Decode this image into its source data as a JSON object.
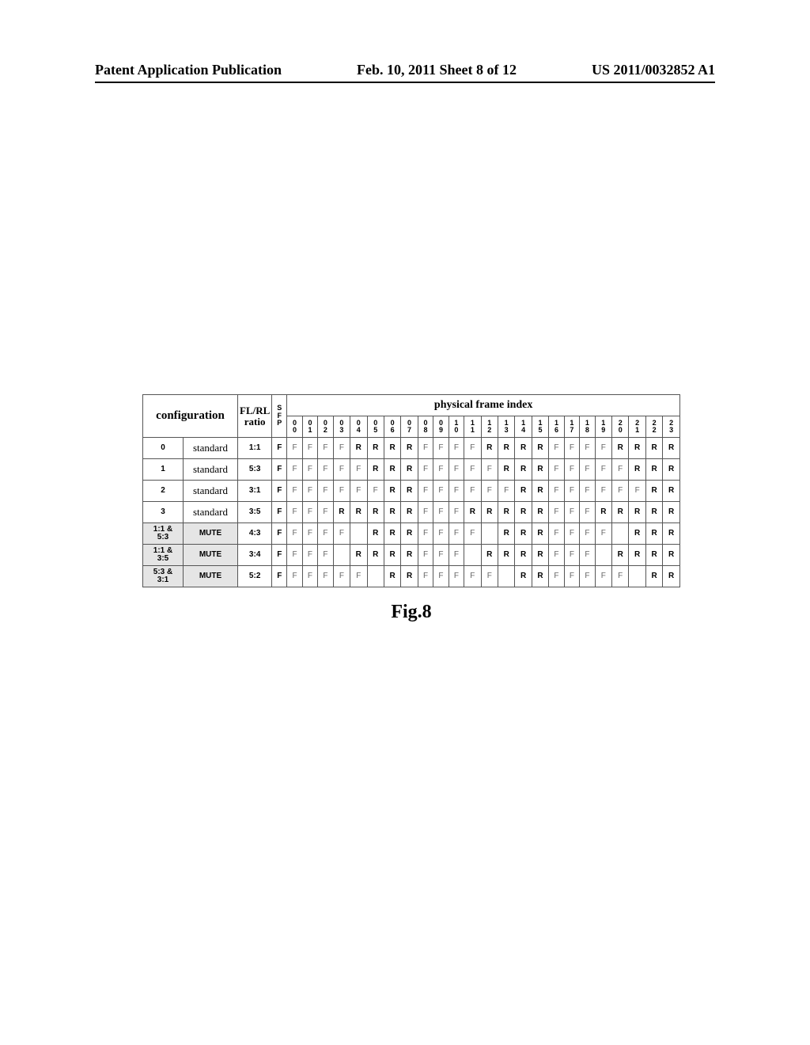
{
  "header": {
    "left": "Patent Application Publication",
    "mid": "Feb. 10, 2011  Sheet 8 of 12",
    "right": "US 2011/0032852 A1"
  },
  "labels": {
    "configuration": "configuration",
    "ratio_hdr_l1": "FL/RL",
    "ratio_hdr_l2": "ratio",
    "sfp_l1": "S",
    "sfp_l2": "F",
    "sfp_l3": "P",
    "pfi": "physical frame index",
    "figcap": "Fig.8"
  },
  "cols": [
    {
      "l1": "0",
      "l2": "0"
    },
    {
      "l1": "0",
      "l2": "1"
    },
    {
      "l1": "0",
      "l2": "2"
    },
    {
      "l1": "0",
      "l2": "3"
    },
    {
      "l1": "0",
      "l2": "4"
    },
    {
      "l1": "0",
      "l2": "5"
    },
    {
      "l1": "0",
      "l2": "6"
    },
    {
      "l1": "0",
      "l2": "7"
    },
    {
      "l1": "0",
      "l2": "8"
    },
    {
      "l1": "0",
      "l2": "9"
    },
    {
      "l1": "1",
      "l2": "0"
    },
    {
      "l1": "1",
      "l2": "1"
    },
    {
      "l1": "1",
      "l2": "2"
    },
    {
      "l1": "1",
      "l2": "3"
    },
    {
      "l1": "1",
      "l2": "4"
    },
    {
      "l1": "1",
      "l2": "5"
    },
    {
      "l1": "1",
      "l2": "6"
    },
    {
      "l1": "1",
      "l2": "7"
    },
    {
      "l1": "1",
      "l2": "8"
    },
    {
      "l1": "1",
      "l2": "9"
    },
    {
      "l1": "2",
      "l2": "0"
    },
    {
      "l1": "2",
      "l2": "1"
    },
    {
      "l1": "2",
      "l2": "2"
    },
    {
      "l1": "2",
      "l2": "3"
    }
  ],
  "rows": [
    {
      "cfg1": "0",
      "cfg2": "standard",
      "ratio": "1:1",
      "sfp": "F",
      "mute": false,
      "cells": [
        {
          "t": "F",
          "b": false
        },
        {
          "t": "F",
          "b": false
        },
        {
          "t": "F",
          "b": false
        },
        {
          "t": "F",
          "b": false
        },
        {
          "t": "R",
          "b": true
        },
        {
          "t": "R",
          "b": true
        },
        {
          "t": "R",
          "b": true
        },
        {
          "t": "R",
          "b": true
        },
        {
          "t": "F",
          "b": false
        },
        {
          "t": "F",
          "b": false
        },
        {
          "t": "F",
          "b": false
        },
        {
          "t": "F",
          "b": false
        },
        {
          "t": "R",
          "b": true
        },
        {
          "t": "R",
          "b": true
        },
        {
          "t": "R",
          "b": true
        },
        {
          "t": "R",
          "b": true
        },
        {
          "t": "F",
          "b": false
        },
        {
          "t": "F",
          "b": false
        },
        {
          "t": "F",
          "b": false
        },
        {
          "t": "F",
          "b": false
        },
        {
          "t": "R",
          "b": true
        },
        {
          "t": "R",
          "b": true
        },
        {
          "t": "R",
          "b": true
        },
        {
          "t": "R",
          "b": true
        }
      ]
    },
    {
      "cfg1": "1",
      "cfg2": "standard",
      "ratio": "5:3",
      "sfp": "F",
      "mute": false,
      "cells": [
        {
          "t": "F",
          "b": false
        },
        {
          "t": "F",
          "b": false
        },
        {
          "t": "F",
          "b": false
        },
        {
          "t": "F",
          "b": false
        },
        {
          "t": "F",
          "b": false
        },
        {
          "t": "R",
          "b": true
        },
        {
          "t": "R",
          "b": true
        },
        {
          "t": "R",
          "b": true
        },
        {
          "t": "F",
          "b": false
        },
        {
          "t": "F",
          "b": false
        },
        {
          "t": "F",
          "b": false
        },
        {
          "t": "F",
          "b": false
        },
        {
          "t": "F",
          "b": false
        },
        {
          "t": "R",
          "b": true
        },
        {
          "t": "R",
          "b": true
        },
        {
          "t": "R",
          "b": true
        },
        {
          "t": "F",
          "b": false
        },
        {
          "t": "F",
          "b": false
        },
        {
          "t": "F",
          "b": false
        },
        {
          "t": "F",
          "b": false
        },
        {
          "t": "F",
          "b": false
        },
        {
          "t": "R",
          "b": true
        },
        {
          "t": "R",
          "b": true
        },
        {
          "t": "R",
          "b": true
        }
      ]
    },
    {
      "cfg1": "2",
      "cfg2": "standard",
      "ratio": "3:1",
      "sfp": "F",
      "mute": false,
      "cells": [
        {
          "t": "F",
          "b": false
        },
        {
          "t": "F",
          "b": false
        },
        {
          "t": "F",
          "b": false
        },
        {
          "t": "F",
          "b": false
        },
        {
          "t": "F",
          "b": false
        },
        {
          "t": "F",
          "b": false
        },
        {
          "t": "R",
          "b": true
        },
        {
          "t": "R",
          "b": true
        },
        {
          "t": "F",
          "b": false
        },
        {
          "t": "F",
          "b": false
        },
        {
          "t": "F",
          "b": false
        },
        {
          "t": "F",
          "b": false
        },
        {
          "t": "F",
          "b": false
        },
        {
          "t": "F",
          "b": false
        },
        {
          "t": "R",
          "b": true
        },
        {
          "t": "R",
          "b": true
        },
        {
          "t": "F",
          "b": false
        },
        {
          "t": "F",
          "b": false
        },
        {
          "t": "F",
          "b": false
        },
        {
          "t": "F",
          "b": false
        },
        {
          "t": "F",
          "b": false
        },
        {
          "t": "F",
          "b": false
        },
        {
          "t": "R",
          "b": true
        },
        {
          "t": "R",
          "b": true
        }
      ]
    },
    {
      "cfg1": "3",
      "cfg2": "standard",
      "ratio": "3:5",
      "sfp": "F",
      "mute": false,
      "cells": [
        {
          "t": "F",
          "b": false
        },
        {
          "t": "F",
          "b": false
        },
        {
          "t": "F",
          "b": false
        },
        {
          "t": "R",
          "b": true
        },
        {
          "t": "R",
          "b": true
        },
        {
          "t": "R",
          "b": true
        },
        {
          "t": "R",
          "b": true
        },
        {
          "t": "R",
          "b": true
        },
        {
          "t": "F",
          "b": false
        },
        {
          "t": "F",
          "b": false
        },
        {
          "t": "F",
          "b": false
        },
        {
          "t": "R",
          "b": true
        },
        {
          "t": "R",
          "b": true
        },
        {
          "t": "R",
          "b": true
        },
        {
          "t": "R",
          "b": true
        },
        {
          "t": "R",
          "b": true
        },
        {
          "t": "F",
          "b": false
        },
        {
          "t": "F",
          "b": false
        },
        {
          "t": "F",
          "b": false
        },
        {
          "t": "R",
          "b": true
        },
        {
          "t": "R",
          "b": true
        },
        {
          "t": "R",
          "b": true
        },
        {
          "t": "R",
          "b": true
        },
        {
          "t": "R",
          "b": true
        }
      ]
    },
    {
      "cfg1": "1:1 & 5:3",
      "cfg2": "MUTE",
      "ratio": "4:3",
      "sfp": "F",
      "mute": true,
      "cells": [
        {
          "t": "F",
          "b": false
        },
        {
          "t": "F",
          "b": false
        },
        {
          "t": "F",
          "b": false
        },
        {
          "t": "F",
          "b": false
        },
        {
          "t": "",
          "b": false
        },
        {
          "t": "R",
          "b": true
        },
        {
          "t": "R",
          "b": true
        },
        {
          "t": "R",
          "b": true
        },
        {
          "t": "F",
          "b": false
        },
        {
          "t": "F",
          "b": false
        },
        {
          "t": "F",
          "b": false
        },
        {
          "t": "F",
          "b": false
        },
        {
          "t": "",
          "b": false
        },
        {
          "t": "R",
          "b": true
        },
        {
          "t": "R",
          "b": true
        },
        {
          "t": "R",
          "b": true
        },
        {
          "t": "F",
          "b": false
        },
        {
          "t": "F",
          "b": false
        },
        {
          "t": "F",
          "b": false
        },
        {
          "t": "F",
          "b": false
        },
        {
          "t": "",
          "b": false
        },
        {
          "t": "R",
          "b": true
        },
        {
          "t": "R",
          "b": true
        },
        {
          "t": "R",
          "b": true
        }
      ]
    },
    {
      "cfg1": "1:1 & 3:5",
      "cfg2": "MUTE",
      "ratio": "3:4",
      "sfp": "F",
      "mute": true,
      "cells": [
        {
          "t": "F",
          "b": false
        },
        {
          "t": "F",
          "b": false
        },
        {
          "t": "F",
          "b": false
        },
        {
          "t": "",
          "b": false
        },
        {
          "t": "R",
          "b": true
        },
        {
          "t": "R",
          "b": true
        },
        {
          "t": "R",
          "b": true
        },
        {
          "t": "R",
          "b": true
        },
        {
          "t": "F",
          "b": false
        },
        {
          "t": "F",
          "b": false
        },
        {
          "t": "F",
          "b": false
        },
        {
          "t": "",
          "b": false
        },
        {
          "t": "R",
          "b": true
        },
        {
          "t": "R",
          "b": true
        },
        {
          "t": "R",
          "b": true
        },
        {
          "t": "R",
          "b": true
        },
        {
          "t": "F",
          "b": false
        },
        {
          "t": "F",
          "b": false
        },
        {
          "t": "F",
          "b": false
        },
        {
          "t": "",
          "b": false
        },
        {
          "t": "R",
          "b": true
        },
        {
          "t": "R",
          "b": true
        },
        {
          "t": "R",
          "b": true
        },
        {
          "t": "R",
          "b": true
        }
      ]
    },
    {
      "cfg1": "5:3 & 3:1",
      "cfg2": "MUTE",
      "ratio": "5:2",
      "sfp": "F",
      "mute": true,
      "cells": [
        {
          "t": "F",
          "b": false
        },
        {
          "t": "F",
          "b": false
        },
        {
          "t": "F",
          "b": false
        },
        {
          "t": "F",
          "b": false
        },
        {
          "t": "F",
          "b": false
        },
        {
          "t": "",
          "b": false
        },
        {
          "t": "R",
          "b": true
        },
        {
          "t": "R",
          "b": true
        },
        {
          "t": "F",
          "b": false
        },
        {
          "t": "F",
          "b": false
        },
        {
          "t": "F",
          "b": false
        },
        {
          "t": "F",
          "b": false
        },
        {
          "t": "F",
          "b": false
        },
        {
          "t": "",
          "b": false
        },
        {
          "t": "R",
          "b": true
        },
        {
          "t": "R",
          "b": true
        },
        {
          "t": "F",
          "b": false
        },
        {
          "t": "F",
          "b": false
        },
        {
          "t": "F",
          "b": false
        },
        {
          "t": "F",
          "b": false
        },
        {
          "t": "F",
          "b": false
        },
        {
          "t": "",
          "b": false
        },
        {
          "t": "R",
          "b": true
        },
        {
          "t": "R",
          "b": true
        }
      ]
    }
  ],
  "chart_data": {
    "type": "table",
    "title": "physical frame index",
    "columns": [
      "configuration_id",
      "type",
      "FL/RL ratio",
      "SFP",
      "00",
      "01",
      "02",
      "03",
      "04",
      "05",
      "06",
      "07",
      "08",
      "09",
      "10",
      "11",
      "12",
      "13",
      "14",
      "15",
      "16",
      "17",
      "18",
      "19",
      "20",
      "21",
      "22",
      "23"
    ],
    "rows": [
      [
        "0",
        "standard",
        "1:1",
        "F",
        "F",
        "F",
        "F",
        "F",
        "R",
        "R",
        "R",
        "R",
        "F",
        "F",
        "F",
        "F",
        "R",
        "R",
        "R",
        "R",
        "F",
        "F",
        "F",
        "F",
        "R",
        "R",
        "R",
        "R"
      ],
      [
        "1",
        "standard",
        "5:3",
        "F",
        "F",
        "F",
        "F",
        "F",
        "F",
        "R",
        "R",
        "R",
        "F",
        "F",
        "F",
        "F",
        "F",
        "R",
        "R",
        "R",
        "F",
        "F",
        "F",
        "F",
        "F",
        "R",
        "R",
        "R"
      ],
      [
        "2",
        "standard",
        "3:1",
        "F",
        "F",
        "F",
        "F",
        "F",
        "F",
        "F",
        "R",
        "R",
        "F",
        "F",
        "F",
        "F",
        "F",
        "F",
        "R",
        "R",
        "F",
        "F",
        "F",
        "F",
        "F",
        "F",
        "R",
        "R"
      ],
      [
        "3",
        "standard",
        "3:5",
        "F",
        "F",
        "F",
        "F",
        "R",
        "R",
        "R",
        "R",
        "R",
        "F",
        "F",
        "F",
        "R",
        "R",
        "R",
        "R",
        "R",
        "F",
        "F",
        "F",
        "R",
        "R",
        "R",
        "R",
        "R"
      ],
      [
        "1:1 & 5:3",
        "MUTE",
        "4:3",
        "F",
        "F",
        "F",
        "F",
        "F",
        "",
        "R",
        "R",
        "R",
        "F",
        "F",
        "F",
        "F",
        "",
        "R",
        "R",
        "R",
        "F",
        "F",
        "F",
        "F",
        "",
        "R",
        "R",
        "R"
      ],
      [
        "1:1 & 3:5",
        "MUTE",
        "3:4",
        "F",
        "F",
        "F",
        "F",
        "",
        "R",
        "R",
        "R",
        "R",
        "F",
        "F",
        "F",
        "",
        "R",
        "R",
        "R",
        "R",
        "F",
        "F",
        "F",
        "",
        "R",
        "R",
        "R",
        "R"
      ],
      [
        "5:3 & 3:1",
        "MUTE",
        "5:2",
        "F",
        "F",
        "F",
        "F",
        "F",
        "F",
        "",
        "R",
        "R",
        "F",
        "F",
        "F",
        "F",
        "F",
        "",
        "R",
        "R",
        "F",
        "F",
        "F",
        "F",
        "F",
        "",
        "R",
        "R"
      ]
    ]
  }
}
